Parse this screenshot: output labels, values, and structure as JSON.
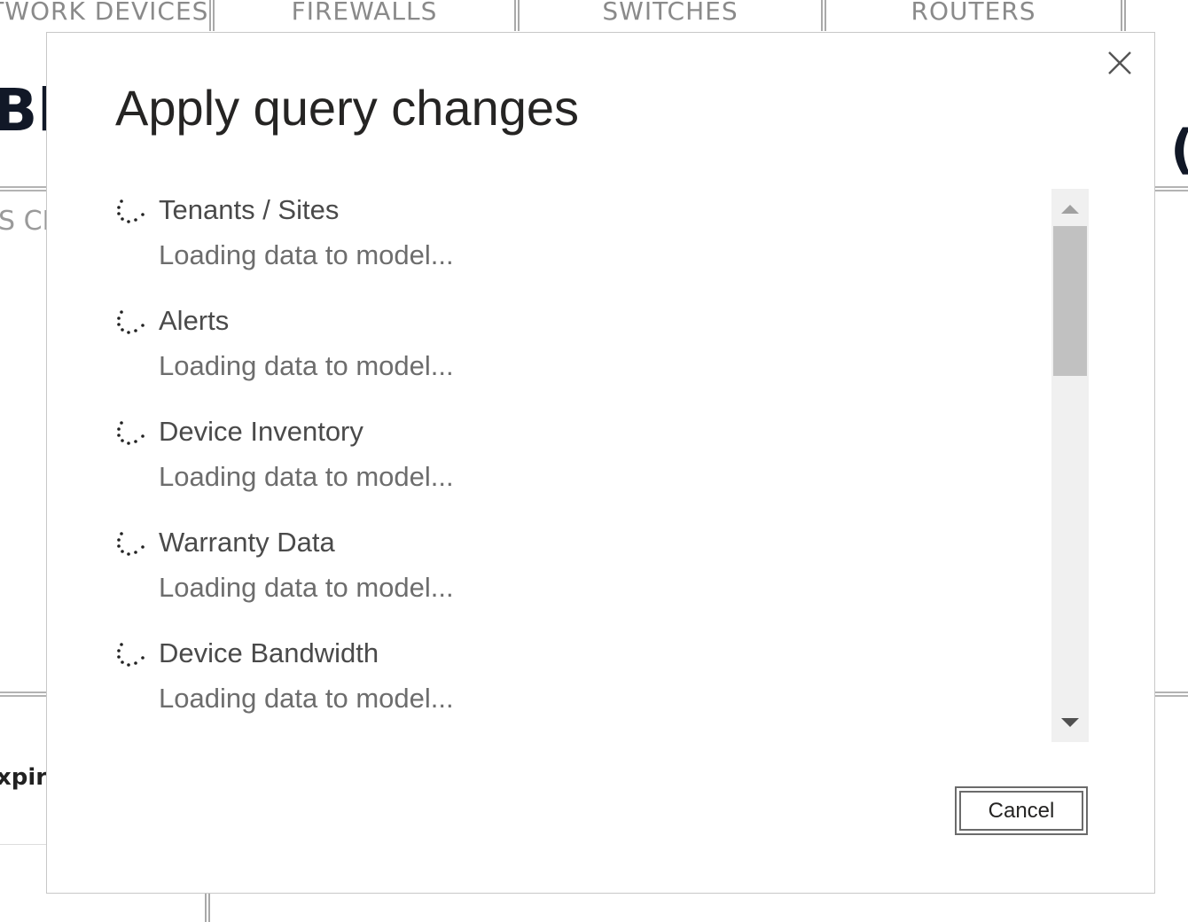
{
  "background": {
    "tabs": [
      {
        "label": "NETWORK DEVICES"
      },
      {
        "label": "FIREWALLS"
      },
      {
        "label": "SWITCHES"
      },
      {
        "label": "ROUTERS"
      }
    ],
    "left_heading_fragment": "Bla",
    "right_heading_fragment": "(",
    "left_subheading_fragment": "S CF",
    "left_column_fragment": "xpira"
  },
  "dialog": {
    "title": "Apply query changes",
    "close_icon": "close-icon",
    "queries": [
      {
        "name": "Tenants / Sites",
        "status": "Loading data to model..."
      },
      {
        "name": "Alerts",
        "status": "Loading data to model..."
      },
      {
        "name": "Device Inventory",
        "status": "Loading data to model..."
      },
      {
        "name": "Warranty Data",
        "status": "Loading data to model..."
      },
      {
        "name": "Device Bandwidth",
        "status": "Loading data to model..."
      }
    ],
    "cancel_label": "Cancel"
  },
  "colors": {
    "title_text": "#252423",
    "status_text": "#6d6d6d",
    "scrollbar_track": "#f0f0f0",
    "scrollbar_thumb": "#c1c1c1"
  }
}
